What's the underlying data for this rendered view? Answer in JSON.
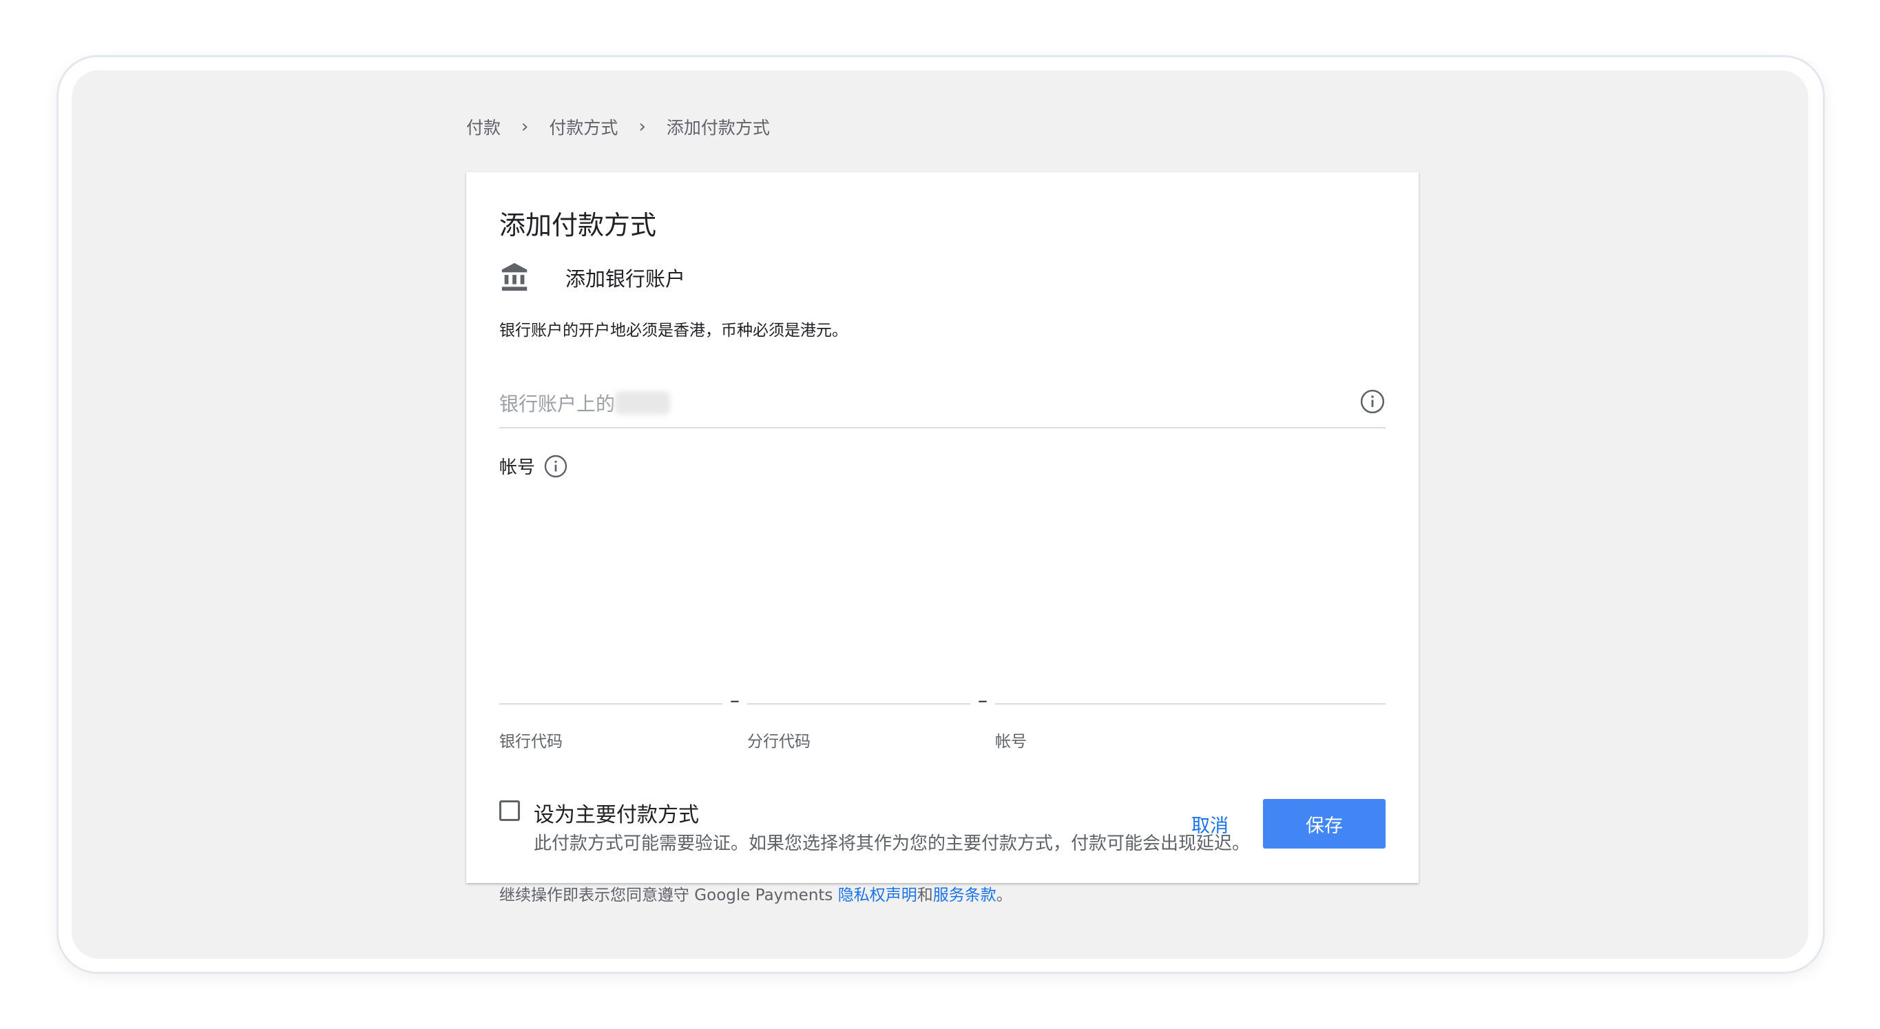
{
  "breadcrumb": {
    "items": [
      "付款",
      "付款方式",
      "添加付款方式"
    ],
    "separator": "›"
  },
  "card": {
    "title": "添加付款方式",
    "bank_label": "添加银行账户",
    "notice": "银行账户的开户地必须是香港，币种必须是港元。",
    "name_field": {
      "placeholder": "银行账户上的",
      "value": ""
    },
    "account": {
      "label": "帐号",
      "segments": [
        {
          "hint": "银行代码",
          "value": ""
        },
        {
          "hint": "分行代码",
          "value": ""
        },
        {
          "hint": "帐号",
          "value": ""
        }
      ],
      "dash": "–"
    },
    "primary_checkbox": {
      "checked": false,
      "title": "设为主要付款方式",
      "description": "此付款方式可能需要验证。如果您选择将其作为您的主要付款方式，付款可能会出现延迟。"
    },
    "terms": {
      "prefix": "继续操作即表示您同意遵守 Google Payments ",
      "privacy_link": "隐私权声明",
      "middle": "和",
      "tos_link": "服务条款",
      "suffix": "。"
    },
    "actions": {
      "cancel": "取消",
      "save": "保存"
    }
  },
  "colors": {
    "accent": "#4285f4",
    "link": "#1a73e8",
    "background": "#f1f1f1"
  }
}
